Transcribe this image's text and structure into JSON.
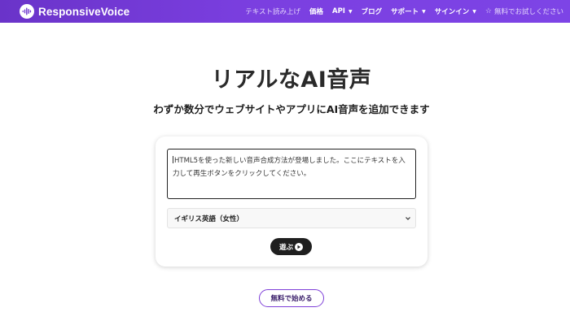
{
  "header": {
    "brand": "ResponsiveVoice",
    "nav": {
      "text_to_speech": "テキスト読み上げ",
      "pricing": "価格",
      "api": "API",
      "blog": "ブログ",
      "support": "サポート",
      "signin": "サインイン",
      "free_trial": "無料でお試しください"
    },
    "colors": {
      "bar_start": "#6a33c9",
      "bar_end": "#7d44e6"
    }
  },
  "hero": {
    "title": "リアルなAI音声",
    "subtitle": "わずか数分でウェブサイトやアプリにAI音声を追加できます"
  },
  "demo": {
    "textarea_value": "HTML5を使った新しい音声合成方法が登場しました。ここにテキストを入力して再生ボタンをクリックしてください。",
    "voice_select": {
      "selected": "イギリス英語（女性）"
    },
    "play_label": "遊ぶ"
  },
  "cta": {
    "label": "無料で始める",
    "border_color": "#7e3fd8"
  }
}
